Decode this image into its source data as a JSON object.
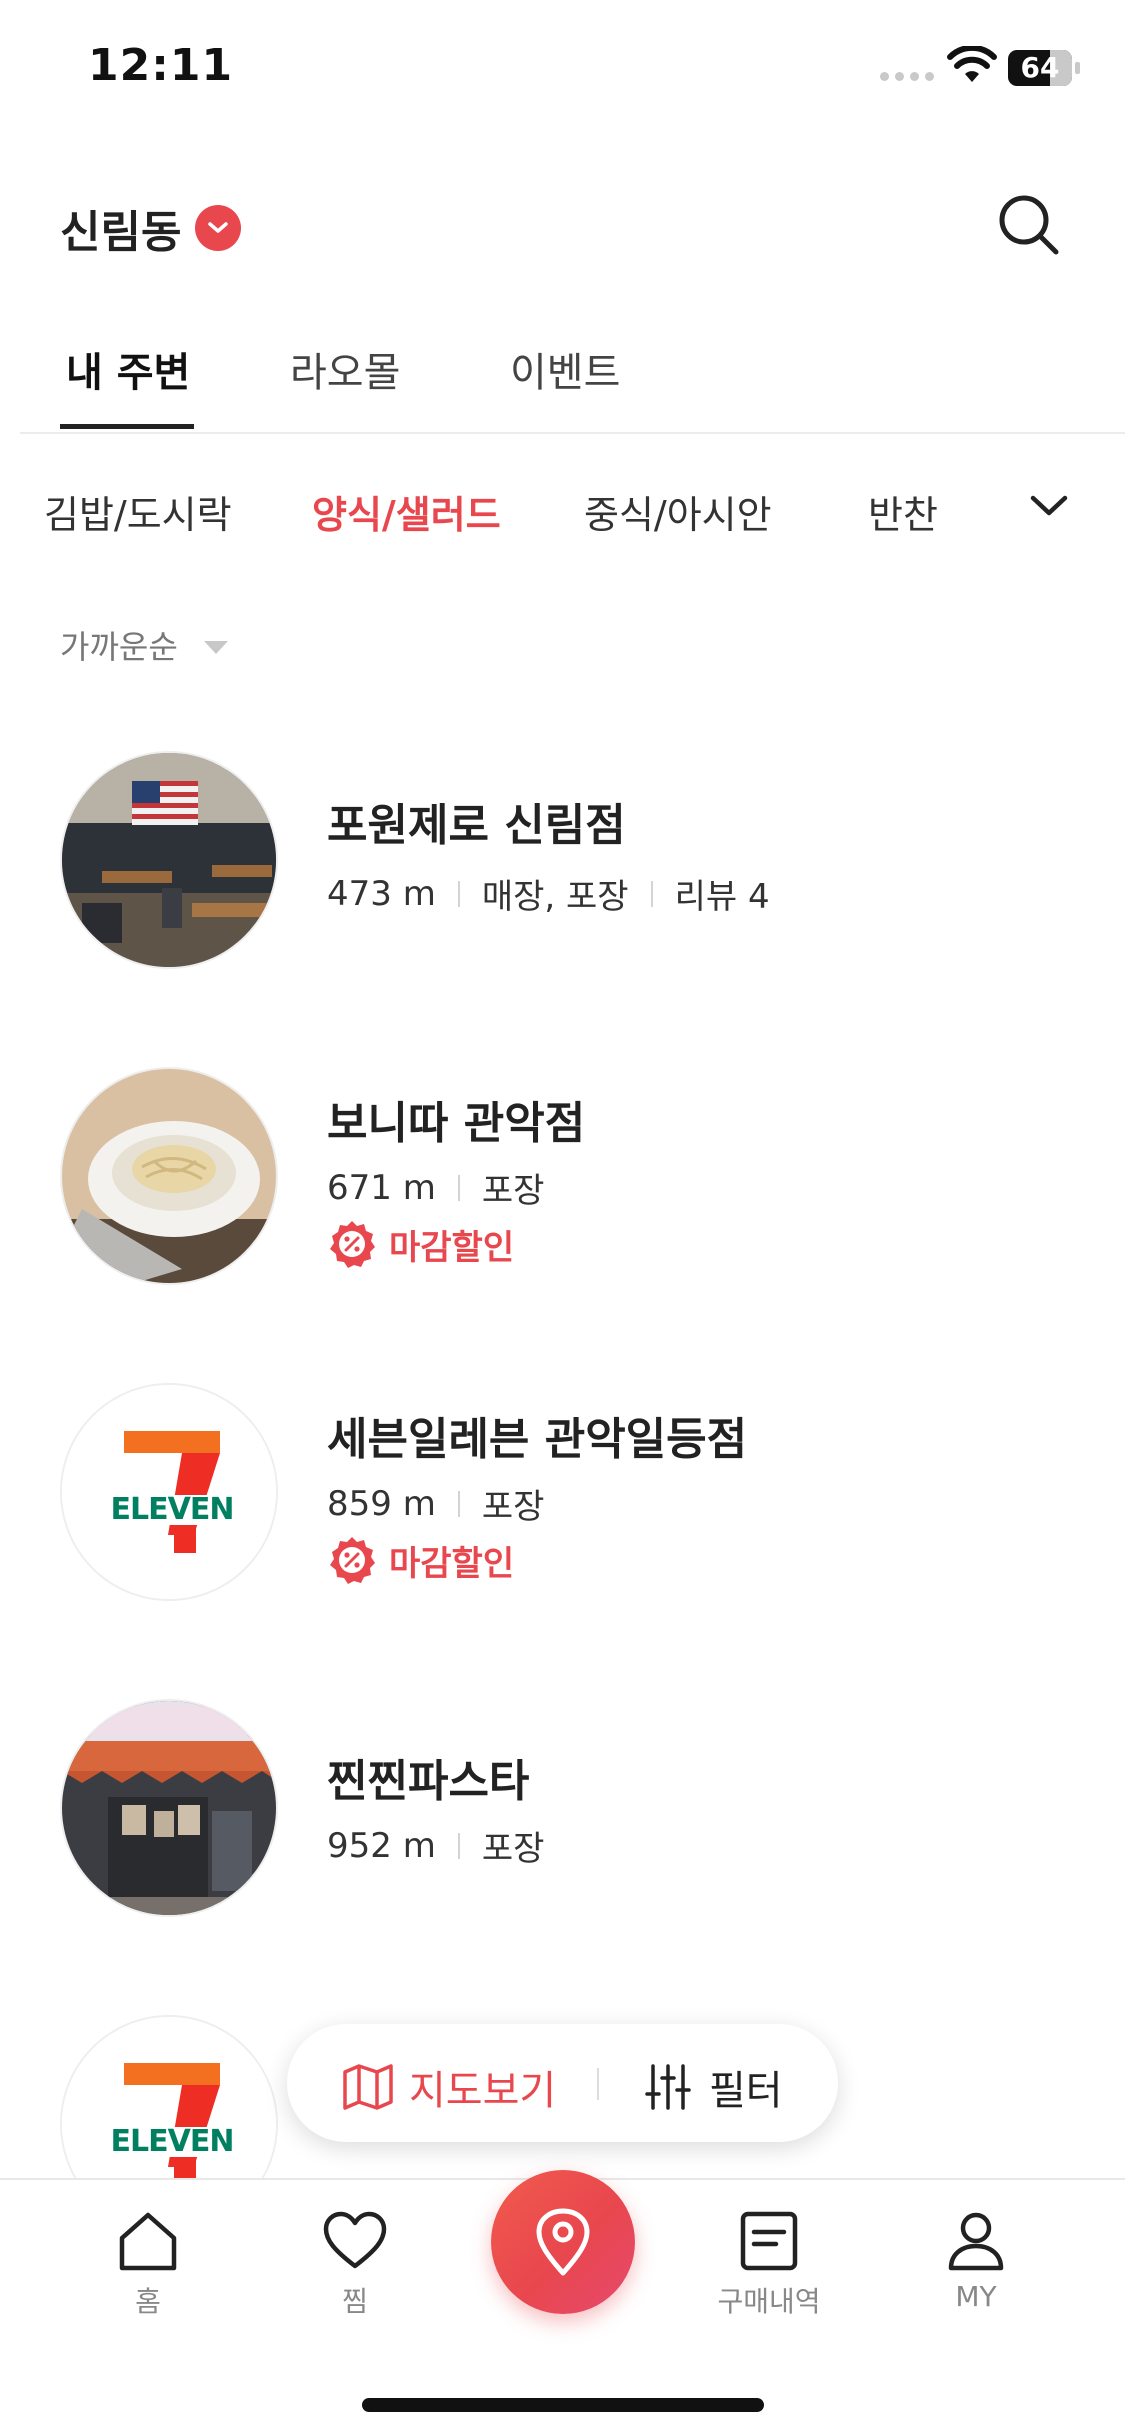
{
  "status_bar": {
    "time": "12:11",
    "battery": "64"
  },
  "header": {
    "location": "신림동"
  },
  "tabs": [
    {
      "label": "내 주변",
      "active": true
    },
    {
      "label": "라오몰",
      "active": false
    },
    {
      "label": "이벤트",
      "active": false
    }
  ],
  "categories": [
    {
      "label": "김밥/도시락",
      "active": false
    },
    {
      "label": "양식/샐러드",
      "active": true
    },
    {
      "label": "중식/아시안",
      "active": false
    },
    {
      "label": "반찬",
      "active": false
    }
  ],
  "sort": {
    "label": "가까운순"
  },
  "stores": [
    {
      "name": "포원제로 신림점",
      "distance": "473 m",
      "service": "매장, 포장",
      "review": "리뷰 4",
      "thumb": "restaurant-photo"
    },
    {
      "name": "보니따 관악점",
      "distance": "671 m",
      "service": "포장",
      "discount": "마감할인",
      "thumb": "pasta-photo"
    },
    {
      "name": "세븐일레븐 관악일등점",
      "distance": "859 m",
      "service": "포장",
      "discount": "마감할인",
      "thumb": "seven-eleven-logo"
    },
    {
      "name": "찐찐파스타",
      "distance": "952 m",
      "service": "포장",
      "thumb": "storefront-photo"
    }
  ],
  "floating": {
    "map_label": "지도보기",
    "filter_label": "필터"
  },
  "bottom_nav": [
    {
      "label": "홈",
      "icon": "home-icon"
    },
    {
      "label": "찜",
      "icon": "heart-icon"
    },
    {
      "label": "",
      "icon": "location-pin-icon"
    },
    {
      "label": "구매내역",
      "icon": "receipt-icon"
    },
    {
      "label": "MY",
      "icon": "user-icon"
    }
  ],
  "colors": {
    "accent": "#e8474e",
    "text": "#222222",
    "muted": "#888888"
  }
}
